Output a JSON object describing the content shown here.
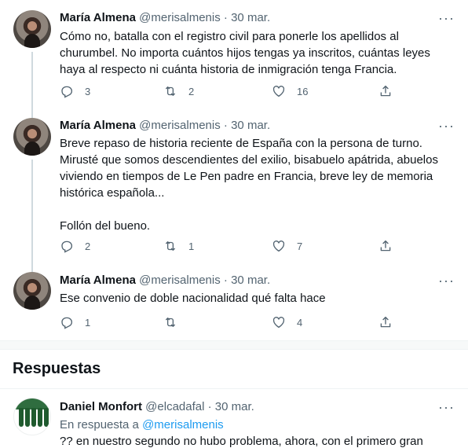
{
  "tweets": [
    {
      "name": "María Almena",
      "handle": "@merisalmenis",
      "dot": "·",
      "time": "30 mar.",
      "text": "Cómo no, batalla con el registro civil para ponerle los apellidos al churumbel. No importa cuántos hijos tengas ya inscritos, cuántas leyes haya al respecto ni cuánta historia de inmigración tenga Francia.",
      "replies": "3",
      "retweets": "2",
      "likes": "16"
    },
    {
      "name": "María Almena",
      "handle": "@merisalmenis",
      "dot": "·",
      "time": "30 mar.",
      "text": "Breve repaso de historia reciente de España con la persona de turno. Mirusté que somos descendientes del exilio, bisabuelo apátrida, abuelos viviendo en tiempos de Le Pen padre en Francia, breve ley de memoria histórica española...\n\nFollón del bueno.",
      "replies": "2",
      "retweets": "1",
      "likes": "7"
    },
    {
      "name": "María Almena",
      "handle": "@merisalmenis",
      "dot": "·",
      "time": "30 mar.",
      "text": "Ese convenio de doble nacionalidad qué falta hace",
      "replies": "1",
      "retweets": "",
      "likes": "4"
    }
  ],
  "more_glyph": "···",
  "responses_title": "Respuestas",
  "reply": {
    "name": "Daniel Monfort",
    "handle": "@elcadafal",
    "dot": "·",
    "time": "30 mar.",
    "reply_prefix": "En respuesta a ",
    "reply_mention": "@merisalmenis",
    "text": "?? en nuestro segundo no hubo problema, ahora, con el primero gran"
  },
  "icons": {
    "reply": "reply-icon",
    "retweet": "retweet-icon",
    "like": "heart-icon",
    "share": "share-icon",
    "more": "more-icon"
  },
  "colors": {
    "text": "#0f1419",
    "secondary": "#536471",
    "link": "#1d9bf0",
    "thread_line": "#cfd9de"
  }
}
